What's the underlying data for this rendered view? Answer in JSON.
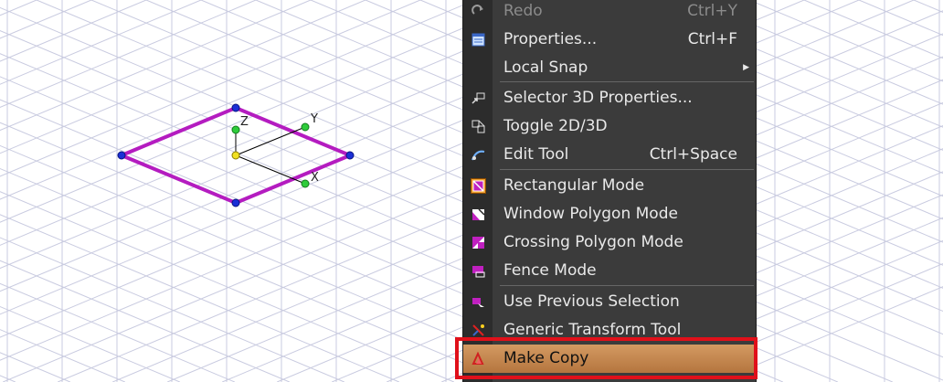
{
  "viewport": {
    "grid_color": "#c9cbe0",
    "shape_color": "#b41cc0",
    "axis_labels": {
      "x": "X",
      "y": "Y",
      "z": "Z"
    }
  },
  "context_menu": {
    "items": [
      {
        "label": "Redo",
        "shortcut": "Ctrl+Y",
        "icon": "redo-icon",
        "state": "disabled"
      },
      {
        "label": "Properties...",
        "shortcut": "Ctrl+F",
        "icon": "properties-icon",
        "state": "normal"
      },
      {
        "label": "Local Snap",
        "shortcut": "",
        "icon": "",
        "state": "submenu"
      },
      {
        "label": "Selector 3D Properties...",
        "shortcut": "",
        "icon": "selector-3d-icon",
        "state": "normal"
      },
      {
        "label": "Toggle 2D/3D",
        "shortcut": "",
        "icon": "toggle-2d3d-icon",
        "state": "normal"
      },
      {
        "label": "Edit Tool",
        "shortcut": "Ctrl+Space",
        "icon": "edit-tool-icon",
        "state": "normal"
      },
      {
        "label": "Rectangular Mode",
        "shortcut": "",
        "icon": "rectangular-mode-icon",
        "state": "checked"
      },
      {
        "label": "Window Polygon Mode",
        "shortcut": "",
        "icon": "window-polygon-icon",
        "state": "normal"
      },
      {
        "label": "Crossing Polygon Mode",
        "shortcut": "",
        "icon": "crossing-polygon-icon",
        "state": "normal"
      },
      {
        "label": "Fence Mode",
        "shortcut": "",
        "icon": "fence-mode-icon",
        "state": "normal"
      },
      {
        "label": "Use Previous Selection",
        "shortcut": "",
        "icon": "previous-selection-icon",
        "state": "normal"
      },
      {
        "label": "Generic Transform Tool",
        "shortcut": "",
        "icon": "transform-tool-icon",
        "state": "normal"
      },
      {
        "label": "Make Copy",
        "shortcut": "",
        "icon": "make-copy-icon",
        "state": "highlighted"
      }
    ],
    "highlight_color": "#c98a50",
    "annotation_color": "#e0101a"
  }
}
